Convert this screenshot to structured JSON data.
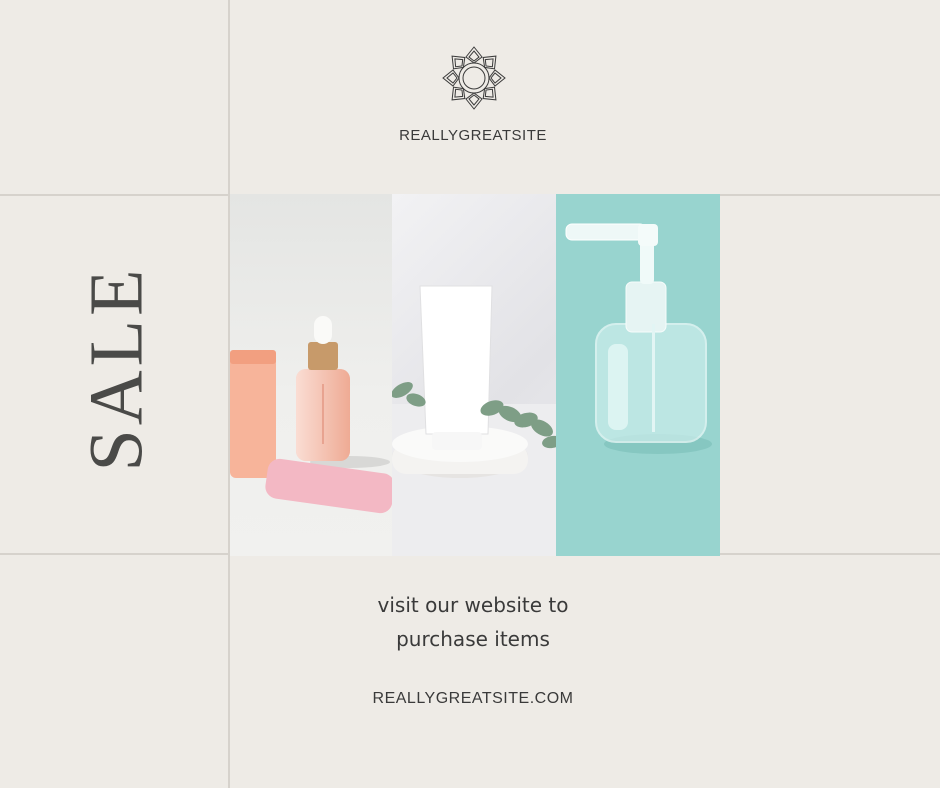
{
  "header": {
    "logo_icon": "mandala-flower-icon",
    "brand_name": "REALLYGREATSITE"
  },
  "banner": {
    "headline": "SALE"
  },
  "gallery": {
    "images": [
      "skincare-serum-and-tubes-photo",
      "white-cream-tube-photo",
      "clear-pump-bottle-photo"
    ]
  },
  "footer": {
    "tagline_line1": "visit our website to",
    "tagline_line2": "purchase items",
    "website": "REALLYGREATSITE.COM"
  },
  "colors": {
    "background": "#EEEBE6",
    "grid_lines": "#D6D2CC",
    "text": "#3A3A3A",
    "accent_teal": "#98D4CF"
  }
}
